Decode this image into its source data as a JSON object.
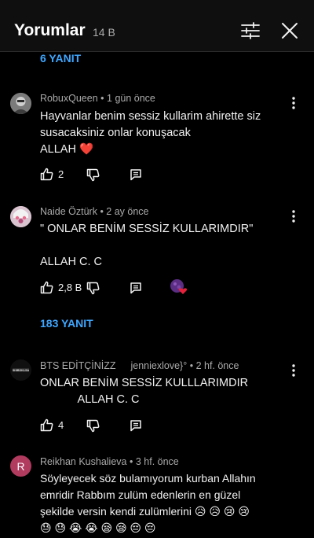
{
  "header": {
    "title": "Yorumlar",
    "count": "14 B"
  },
  "replies_top": "6 YANIT",
  "comments": [
    {
      "author": "RobuxQueen",
      "time": "1 gün önce",
      "lines": [
        "Hayvanlar benim sessiz kullarim ahirette siz",
        "susacaksiniz onlar konuşacak",
        "ALLAH"
      ],
      "heart": "❤️",
      "likes": "2"
    },
    {
      "author": "Naide Öztürk",
      "time": "2 ay önce",
      "lines": [
        "\" ONLAR BENİM SESSİZ KULLARIMDIR\"",
        "",
        "ALLAH C. C"
      ],
      "likes": "2,8 B",
      "replies": "183 YANIT"
    },
    {
      "author": "BTS EDİTÇİNİZZ",
      "author_suffix": "jenniexlove}°",
      "time": "2 hf. önce",
      "lines": [
        "ONLAR BENİM SESSİZ KULLLARIMDIR",
        "            ALLAH C. C"
      ],
      "likes": "4",
      "avatar_text": "SHIBOKLSA"
    },
    {
      "author": "Reikhan Kushalieva",
      "time": "3 hf. önce",
      "avatar_letter": "R",
      "lines": [
        "Söyleyecek söz bulamıyorum kurban Allahın",
        "emridir Rabbım zulüm edenlerin en güzel",
        "şekilde versin kendi zulümlerini 😥 😥 😢 😢",
        "😓 😓 😭 😭 😪 😪 😔 😔"
      ]
    }
  ],
  "colors": {
    "background": "#000000",
    "link": "#3ea6ff",
    "meta": "#aaaaaa",
    "heart": "#e6223b",
    "avatar_r": "#b13a5f"
  }
}
